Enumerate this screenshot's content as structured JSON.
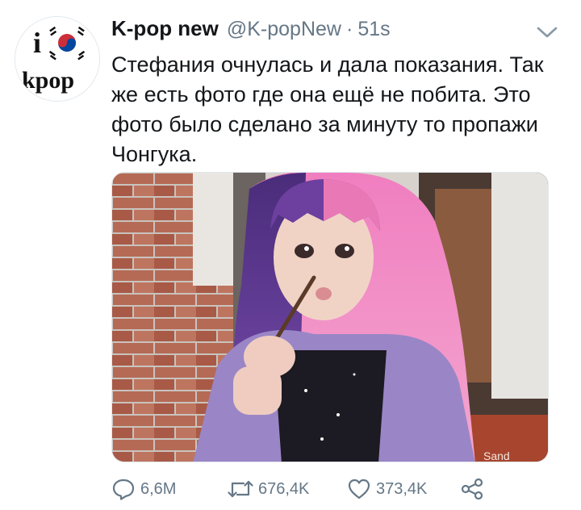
{
  "tweet": {
    "display_name": "K-pop new",
    "handle": "@K-popNew",
    "separator": "·",
    "time": "51s",
    "text": "Стефания очнулась и дала показания. Так же есть фото где она ещё не побита. Это фото было сделано за минуту то пропажи Чонгука.",
    "avatar": {
      "label_top": "i",
      "label_bottom": "kpop",
      "icon": "korean-flag-icon"
    },
    "media": {
      "description_icon": "photo",
      "sign_text": "Sand"
    }
  },
  "actions": {
    "replies": "6,6M",
    "retweets": "676,4K",
    "likes": "373,4K"
  },
  "colors": {
    "text": "#14171a",
    "secondary": "#657786",
    "border": "#e1e8ed"
  }
}
